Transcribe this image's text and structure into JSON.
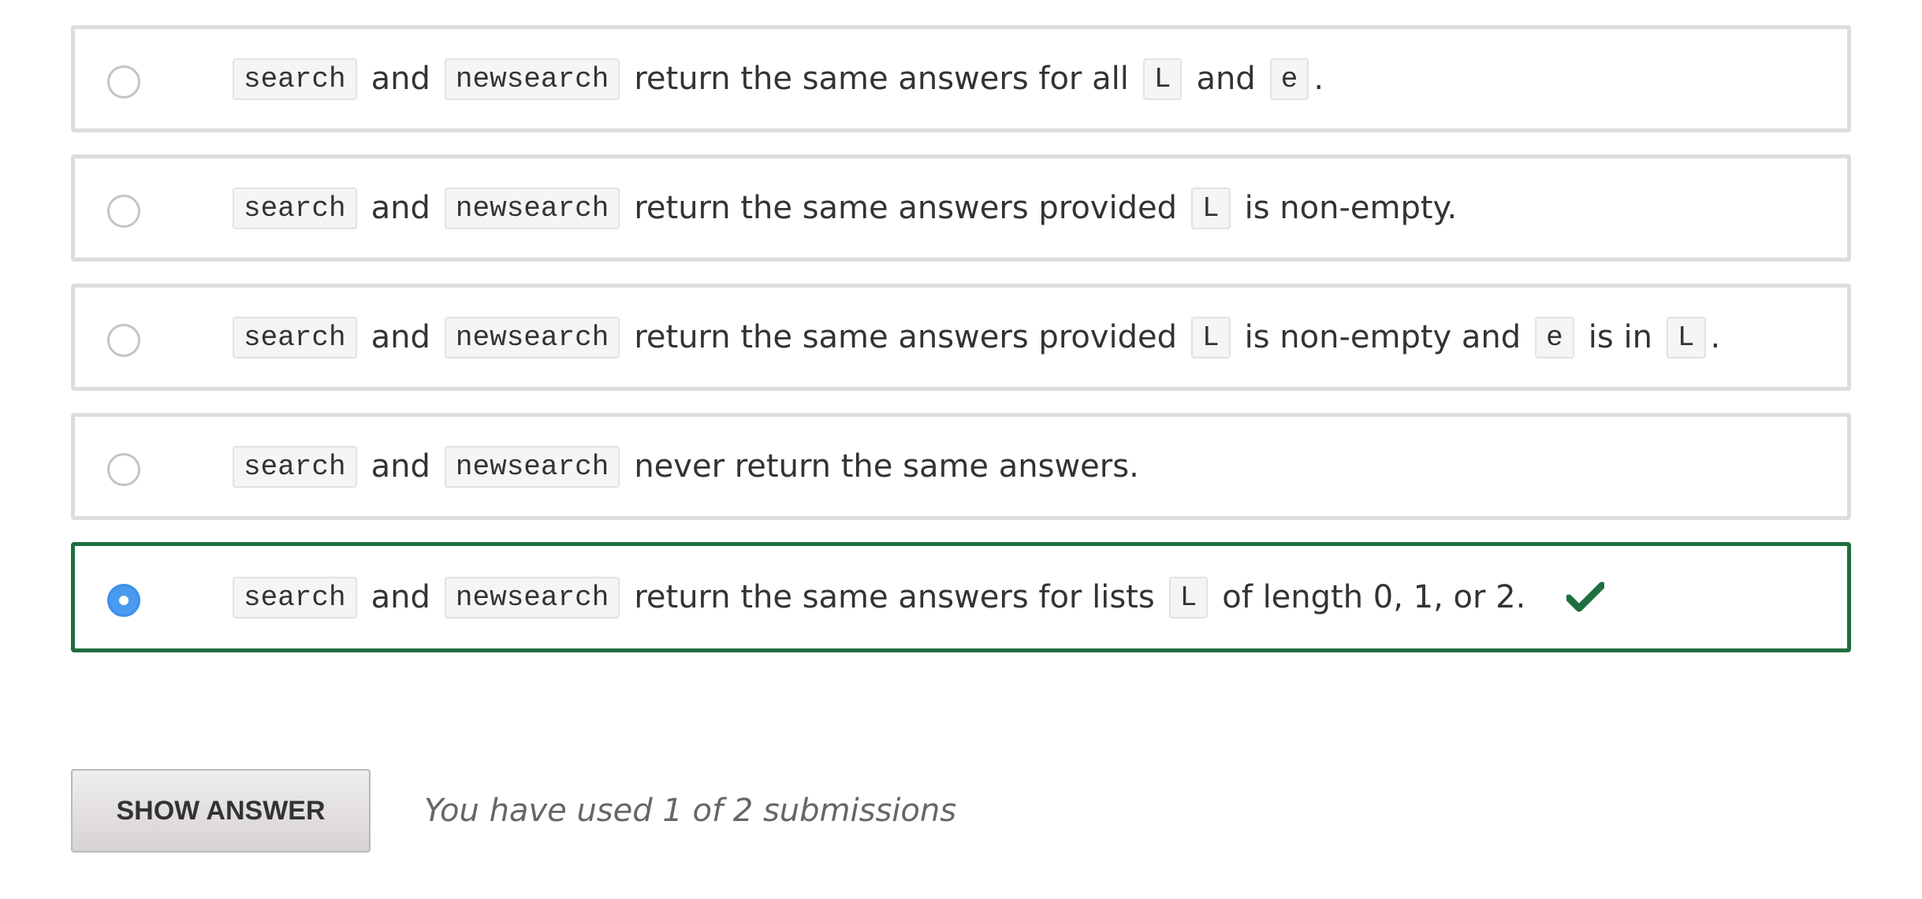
{
  "options": [
    {
      "parts": [
        "search",
        "and",
        "newsearch",
        "return the same answers for all",
        "L",
        "and",
        "e",
        "."
      ],
      "selected": false
    },
    {
      "parts": [
        "search",
        "and",
        "newsearch",
        "return the same answers provided",
        "L",
        "is non-empty."
      ],
      "selected": false
    },
    {
      "parts": [
        "search",
        "and",
        "newsearch",
        "return the same answers provided",
        "L",
        "is non-empty and",
        "e",
        "is in",
        "L",
        "."
      ],
      "selected": false
    },
    {
      "parts": [
        "search",
        "and",
        "newsearch",
        "never return the same answers."
      ],
      "selected": false
    },
    {
      "parts": [
        "search",
        "and",
        "newsearch",
        "return the same answers for lists",
        "L",
        "of length 0, 1, or 2."
      ],
      "selected": true,
      "status_icon": "checkmark-icon"
    }
  ],
  "footer": {
    "show_answer_label": "SHOW ANSWER",
    "submissions_text": "You have used 1 of 2 submissions"
  },
  "colors": {
    "correct_border": "#1e6f3f",
    "selected_radio": "#4a9bf0",
    "check": "#1e6f3f"
  }
}
